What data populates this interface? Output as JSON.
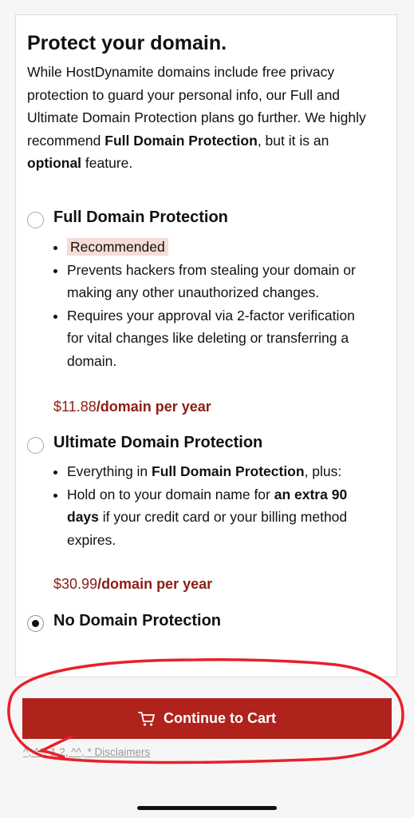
{
  "title": "Protect your domain.",
  "intro": {
    "part1": "While HostDynamite domains include free privacy protection to guard your personal info, our Full and Ultimate Domain Protection plans go further. We highly recommend ",
    "bold1": "Full Domain Protection",
    "part2": ", but it is an ",
    "bold2": "optional",
    "part3": " feature."
  },
  "options": [
    {
      "label": "Full Domain Protection",
      "selected": false,
      "bullets": {
        "b1": "Recommended",
        "b2": "Prevents hackers from stealing your domain or making any other unauthorized changes.",
        "b3": "Requires your approval via 2-factor verification for vital changes like deleting or transferring a domain."
      },
      "price": "$11.88",
      "price_unit": "/domain per year"
    },
    {
      "label": "Ultimate Domain Protection",
      "selected": false,
      "bullets": {
        "b1_pre": "Everything in ",
        "b1_bold": "Full Domain Protection",
        "b1_post": ", plus:",
        "b2_pre": "Hold on to your domain name for ",
        "b2_bold": "an extra 90 days",
        "b2_post": " if your credit card or your billing method expires."
      },
      "price": "$30.99",
      "price_unit": "/domain per year"
    },
    {
      "label": "No Domain Protection",
      "selected": true
    }
  ],
  "cta": {
    "label": "Continue to Cart",
    "icon": "cart-icon",
    "color": "#b0231d"
  },
  "disclaimer": "^, ^^, 1,2, ^^, * Disclaimers",
  "colors": {
    "price": "#8b1d16",
    "recommended_bg": "#f6ddd7",
    "annotation": "#e8202a"
  }
}
